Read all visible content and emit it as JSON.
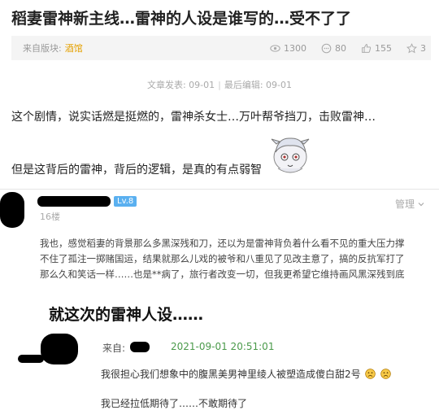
{
  "post": {
    "title": "稻妻雷神新主线…雷神的人设是谁写的…受不了了",
    "source_label": "来自版块:",
    "source_tag": "酒馆",
    "stats": {
      "views": "1300",
      "comments": "80",
      "likes": "155",
      "stars": "3"
    },
    "published": "文章发表: 09-01",
    "edited": "最后编辑: 09-01",
    "body": [
      "这个剧情，说实话燃是挺燃的，雷神杀女士…万叶帮爷挡刀，击败雷神…",
      "但是这背后的雷神，背后的逻辑，是真的有点弱智"
    ]
  },
  "reply": {
    "level": "Lv.8",
    "floor": "16楼",
    "manage": "管理",
    "lines": [
      "我也，感觉稻妻的背景那么多黑深残和刀，还以为是雷神背负着什么看不见的重大压力撑",
      "不住了孤注一掷赌国运，结果就那么儿戏的被爷和八重见了见改主意了，搞的反抗军打了",
      "那么久和笑话一样……也是**病了，旅行者改变一切，但我更希望它维持画风黑深残到底"
    ]
  },
  "caption": "就这次的雷神人设……",
  "comment": {
    "from": "来自:",
    "time": "2021-09-01 20:51:01",
    "text": "我很担心我们想象中的腹黑美男神里绫人被塑造成傻白甜2号",
    "last": "我已经拉低期待了……不敢期待了"
  },
  "colors": {
    "accent": "#e5a100",
    "level_badge": "#5ab0f0",
    "time_green": "#4a9a4a"
  }
}
